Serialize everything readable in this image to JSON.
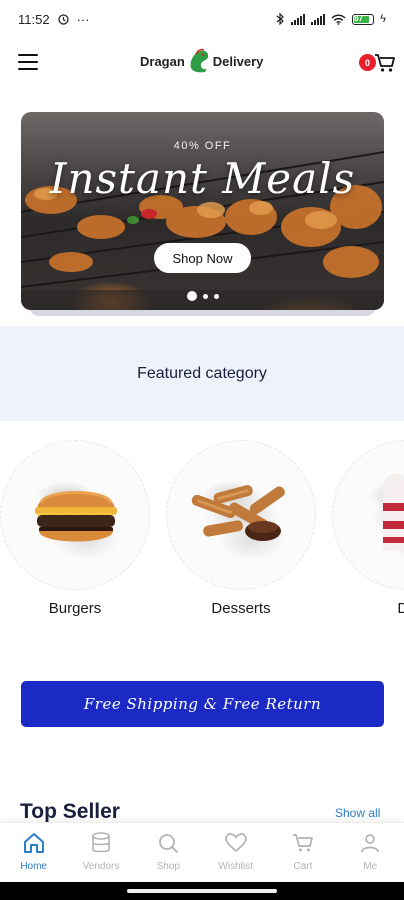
{
  "status_bar": {
    "time": "11:52",
    "dots": "···",
    "battery_pct": "87",
    "charging": "ϟ"
  },
  "header": {
    "logo_left": "Dragan",
    "logo_right": "Delivery",
    "cart_count": "0"
  },
  "banner": {
    "offer": "40% OFF",
    "title": "Instant Meals",
    "button_label": "Shop Now",
    "slides": 3,
    "active_slide": 1
  },
  "featured": {
    "heading": "Featured category"
  },
  "categories": [
    {
      "label": "Burgers",
      "icon": "burger-image"
    },
    {
      "label": "Desserts",
      "icon": "churros-image"
    },
    {
      "label": "Dri",
      "icon": "drink-image"
    }
  ],
  "promo": {
    "label": "Free Shipping & Free Return"
  },
  "top_seller": {
    "heading": "Top Seller",
    "show_all": "Show all"
  },
  "bottom_nav": [
    {
      "label": "Home",
      "icon": "home-icon",
      "active": true
    },
    {
      "label": "Vendors",
      "icon": "database-icon",
      "active": false
    },
    {
      "label": "Shop",
      "icon": "search-icon",
      "active": false
    },
    {
      "label": "Wishlist",
      "icon": "heart-icon",
      "active": false
    },
    {
      "label": "Cart",
      "icon": "cart-icon",
      "active": false
    },
    {
      "label": "Me",
      "icon": "person-icon",
      "active": false
    }
  ],
  "colors": {
    "accent": "#2d7ec9",
    "promo": "#1c2ac5",
    "badge": "#e8202a",
    "featured_bg": "#eef2fb"
  }
}
